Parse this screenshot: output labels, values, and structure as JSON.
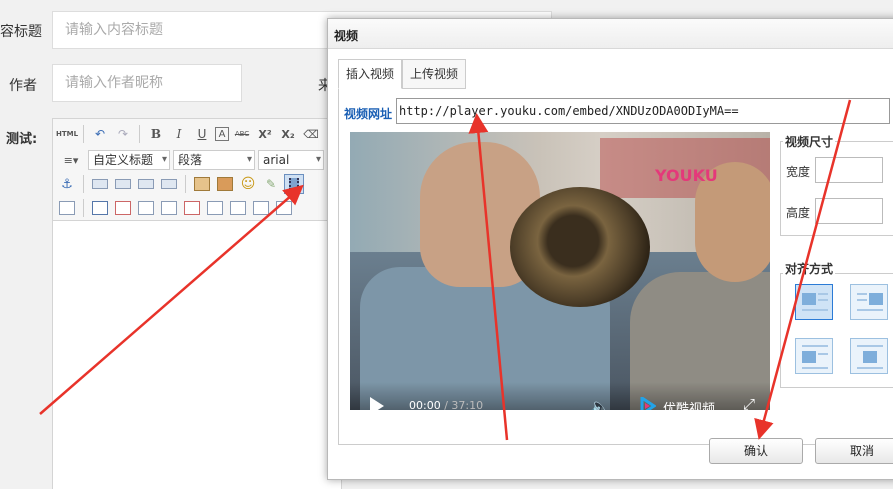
{
  "form": {
    "title_label": "容标题",
    "title_placeholder": "请输入内容标题",
    "author_label": "作者",
    "author_placeholder": "请输入作者昵称",
    "source_label_partial": "来",
    "test_label": "测试:"
  },
  "editor": {
    "toolbar": {
      "html_label": "HTML",
      "bold": "B",
      "italic": "I",
      "underline": "U",
      "font_border": "A",
      "strike": "ABC",
      "superscript": "X²",
      "subscript": "X₂",
      "custom_heading": "自定义标题",
      "paragraph": "段落",
      "font_family": "arial"
    }
  },
  "dialog": {
    "title": "视频",
    "tabs": [
      {
        "label": "插入视频",
        "active": true
      },
      {
        "label": "上传视频",
        "active": false
      }
    ],
    "url_label": "视频网址",
    "url_value": "http://player.youku.com/embed/XNDUzODA0ODIyMA==",
    "video": {
      "logo": "YOUKU",
      "current_time": "00:00",
      "duration": "37:10",
      "brand": "优酷视频"
    },
    "size_section": {
      "title": "视频尺寸",
      "width_label": "宽度",
      "height_label": "高度",
      "width_value": "",
      "height_value": ""
    },
    "align_section": {
      "title": "对齐方式"
    },
    "buttons": {
      "confirm": "确认",
      "cancel": "取消"
    }
  },
  "annotation_color": "#e8332a"
}
